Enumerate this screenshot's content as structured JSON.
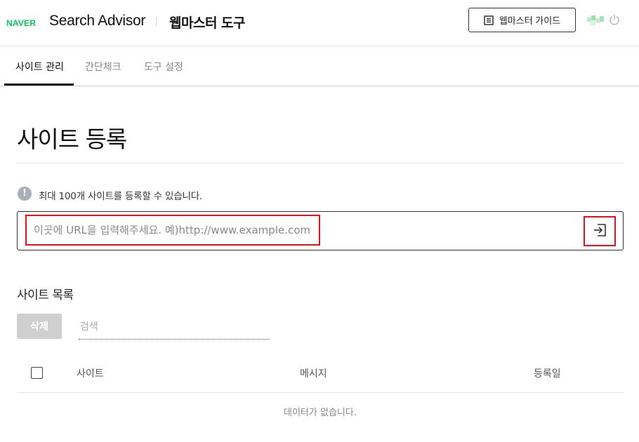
{
  "header": {
    "logo": "NAVER",
    "brand": "Search Advisor",
    "tool_title": "웹마스터 도구",
    "guide_button": "웹마스터 가이드",
    "brand_color": "#03c75a"
  },
  "tabs": [
    {
      "label": "사이트 관리",
      "active": true
    },
    {
      "label": "간단체크",
      "active": false
    },
    {
      "label": "도구 설정",
      "active": false
    }
  ],
  "page": {
    "title": "사이트 등록",
    "info_text": "최대 100개 사이트를 등록할 수 있습니다.",
    "url_placeholder": "이곳에 URL을 입력해주세요. 예)http://www.example.com",
    "url_value": ""
  },
  "site_list": {
    "title": "사이트 목록",
    "delete_button": "삭제",
    "search_placeholder": "검색",
    "columns": [
      "사이트",
      "메시지",
      "등록일"
    ],
    "empty_message": "데이터가 없습니다."
  }
}
